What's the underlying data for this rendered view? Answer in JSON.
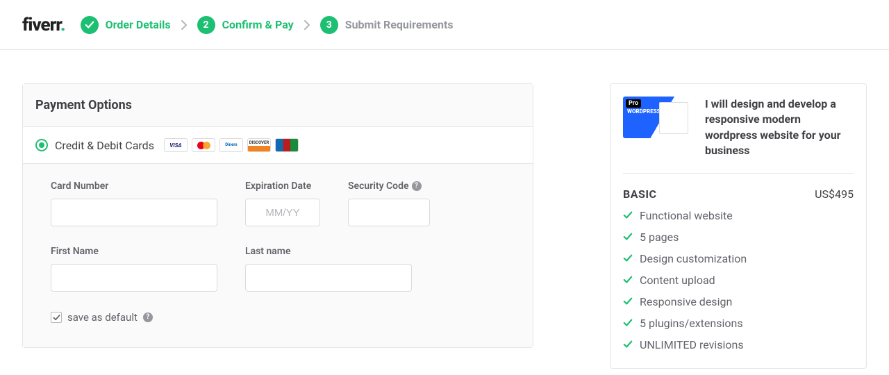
{
  "logo": {
    "text": "fiverr",
    "dot": "."
  },
  "steps": [
    {
      "label": "Order Details",
      "state": "done"
    },
    {
      "label": "Confirm & Pay",
      "state": "active",
      "number": "2"
    },
    {
      "label": "Submit Requirements",
      "state": "upcoming",
      "number": "3"
    }
  ],
  "payment": {
    "heading": "Payment Options",
    "method_label": "Credit & Debit Cards",
    "brands": [
      "visa",
      "mastercard",
      "diners",
      "discover",
      "jcb"
    ],
    "fields": {
      "card_number_label": "Card Number",
      "expiration_label": "Expiration Date",
      "expiration_placeholder": "MM/YY",
      "cvv_label": "Security Code",
      "first_name_label": "First Name",
      "last_name_label": "Last name"
    },
    "save_default_label": "save as default",
    "save_default_checked": true
  },
  "summary": {
    "thumb_badge": "Pro",
    "thumb_text": "WORDPRESS WEBSITES",
    "title": "I will design and develop a responsive modern wordpress website for your business",
    "tier": "BASIC",
    "price": "US$495",
    "features": [
      "Functional website",
      "5 pages",
      "Design customization",
      "Content upload",
      "Responsive design",
      "5 plugins/extensions",
      "UNLIMITED revisions"
    ]
  }
}
